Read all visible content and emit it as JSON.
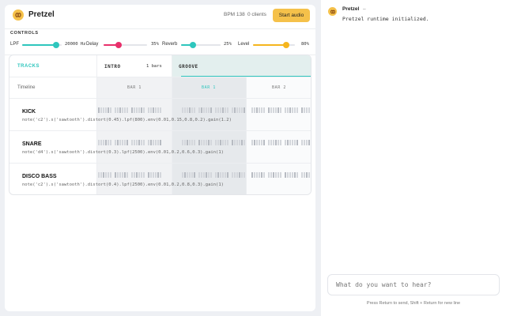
{
  "app": {
    "title": "Pretzel",
    "bpm": "BPM 138",
    "clients": "0 clients",
    "start_label": "Start audio"
  },
  "controls": {
    "label": "CONTROLS",
    "items": [
      {
        "name": "LPF",
        "value": "20000 Hz",
        "fraction": 0.85,
        "color": "#2ec6bd"
      },
      {
        "name": "Delay",
        "value": "35%",
        "fraction": 0.35,
        "color": "#e8306b"
      },
      {
        "name": "Reverb",
        "value": "25%",
        "fraction": 0.3,
        "color": "#2ec6bd"
      },
      {
        "name": "Level",
        "value": "80%",
        "fraction": 0.8,
        "color": "#f5b51e"
      }
    ]
  },
  "grid": {
    "tracks_label": "TRACKS",
    "timeline_label": "Timeline",
    "sections": [
      {
        "name": "INTRO",
        "bars": "1 bars"
      },
      {
        "name": "GROOVE",
        "bars": ""
      }
    ],
    "bars": [
      "BAR 1",
      "BAR 1",
      "BAR 2"
    ],
    "tracks": [
      {
        "name": "KICK",
        "code": "note('c2').s('sawtooth').distort(0.45).lpf(800).env(0.01,0.15,0.8,0.2).gain(1.2)"
      },
      {
        "name": "SNARE",
        "code": "note('d4').s('sawtooth').distort(0.3).lpf(2500).env(0.01,0.2,0.6,0.3).gain(1)"
      },
      {
        "name": "DISCO BASS",
        "code": "note('c2').s('sawtooth').distort(0.4).lpf(2500).env(0.01,0.2,0.8,0.3).gain(1)"
      }
    ]
  },
  "chat": {
    "bot_name": "Pretzel",
    "bot_dash": "–",
    "message": "Pretzel runtime initialized.",
    "placeholder": "What do you want to hear?",
    "hint": "Press Return to send, Shift + Return for new line"
  },
  "colors": {
    "accent": "#f5c14a",
    "teal": "#2ec6bd",
    "pink": "#e8306b"
  }
}
